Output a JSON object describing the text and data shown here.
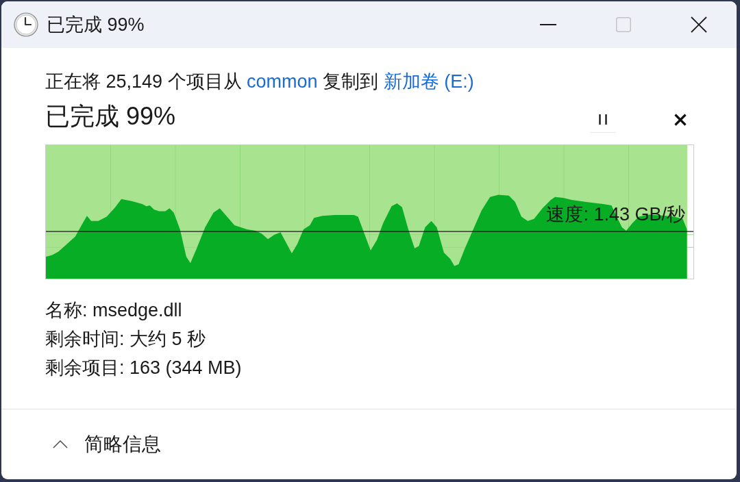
{
  "window": {
    "title": "已完成 99%",
    "controls": [
      {
        "kind": "minimize",
        "disabled": false
      },
      {
        "kind": "maximize",
        "disabled": true
      },
      {
        "kind": "close",
        "disabled": false
      }
    ]
  },
  "summary": [
    {
      "kind": "text",
      "text": "正在将 25,149 个项目从 "
    },
    {
      "kind": "source",
      "text": "common"
    },
    {
      "kind": "text",
      "text": " 复制到 "
    },
    {
      "kind": "destination",
      "text": "新加卷 (E:)"
    }
  ],
  "status": "已完成 99%",
  "actions": [
    {
      "kind": "pause"
    },
    {
      "kind": "cancel"
    }
  ],
  "graph": {
    "progress": {
      "level": 0.99
    },
    "speed": "速度: 1.43 GB/秒"
  },
  "details": [
    "名称: msedge.dll",
    "剩余时间: 大约 5 秒",
    "剩余项目: 163 (344 MB)"
  ],
  "footer": {
    "toggle": {
      "label": "简略信息",
      "expanded": true
    }
  }
}
